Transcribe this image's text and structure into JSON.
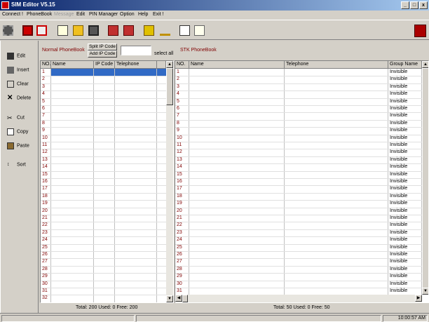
{
  "window": {
    "title": "SIM Editor V5.15",
    "min": "_",
    "max": "□",
    "close": "x"
  },
  "menu": [
    {
      "label": "Connect !",
      "disabled": false
    },
    {
      "label": "PhoneBook",
      "disabled": false
    },
    {
      "label": "Message",
      "disabled": true
    },
    {
      "label": "Edit",
      "disabled": false
    },
    {
      "label": "PIN Manager",
      "disabled": false
    },
    {
      "label": "Option",
      "disabled": false
    },
    {
      "label": "Help",
      "disabled": false
    },
    {
      "label": "Exit !",
      "disabled": false
    }
  ],
  "toolbar": {
    "icons": [
      "connect-icon",
      "phonebook-red-icon",
      "sms-icon",
      "notepad-icon",
      "open-folder-icon",
      "save-disk-icon",
      "read-sim-icon",
      "write-sim-icon",
      "lock-icon",
      "key-icon",
      "copy-pages-icon",
      "chart-icon"
    ],
    "right_logo": "editor-logo-icon"
  },
  "sidebar": [
    {
      "label": "Edit",
      "icon": "edit-icon"
    },
    {
      "label": "Insert",
      "icon": "insert-icon"
    },
    {
      "label": "Clear",
      "icon": "eraser-icon"
    },
    {
      "label": "Delete",
      "icon": "delete-x-icon"
    },
    {
      "label": "Cut",
      "icon": "scissors-icon"
    },
    {
      "label": "Copy",
      "icon": "copy-icon"
    },
    {
      "label": "Paste",
      "icon": "paste-icon"
    },
    {
      "label": "Sort",
      "icon": "sort-az-icon"
    }
  ],
  "normal": {
    "title": "Normal  PhoneBook",
    "split_btn": "Split IP Code",
    "add_btn": "Add IP Code",
    "ip_value": "",
    "select_all": "select all",
    "columns": [
      "NO.",
      "Name",
      "IP Code",
      "Telephone"
    ],
    "rows": [
      "1",
      "2",
      "3",
      "4",
      "5",
      "6",
      "7",
      "8",
      "9",
      "10",
      "11",
      "12",
      "13",
      "14",
      "15",
      "16",
      "17",
      "18",
      "19",
      "20",
      "21",
      "22",
      "23",
      "24",
      "25",
      "26",
      "27",
      "28",
      "29",
      "30",
      "31",
      "32"
    ],
    "footer": "Total: 200  Used: 0  Free: 200"
  },
  "stk": {
    "title": "STK  PhoneBook",
    "columns": [
      "NO.",
      "Name",
      "Telephone",
      "Group Name"
    ],
    "rows": [
      "1",
      "2",
      "3",
      "4",
      "5",
      "6",
      "7",
      "8",
      "9",
      "10",
      "11",
      "12",
      "13",
      "14",
      "15",
      "16",
      "17",
      "18",
      "19",
      "20",
      "21",
      "22",
      "23",
      "24",
      "25",
      "26",
      "27",
      "28",
      "29",
      "30",
      "31"
    ],
    "group_value": "Invisible",
    "footer": "Total: 50  Used: 0  Free: 50"
  },
  "status": {
    "time": "10:00:57 AM"
  },
  "colors": {
    "titlebar": "#0a246a",
    "selection": "#316ac5",
    "header_text": "#800000"
  }
}
